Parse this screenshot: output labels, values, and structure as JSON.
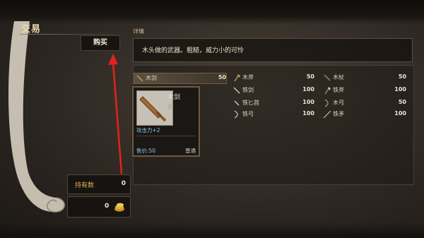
{
  "screen": {
    "title": "交易",
    "buy_label": "购买",
    "detail_label": "详情"
  },
  "description": "木头做的武器。粗糙，威力小的可怜",
  "items": [
    {
      "name": "木剑",
      "price": "50",
      "icon": "sword-icon"
    },
    {
      "name": "木斧",
      "price": "50",
      "icon": "axe-icon"
    },
    {
      "name": "木杖",
      "price": "50",
      "icon": "staff-icon"
    },
    {
      "name": "铁剑",
      "price": "100",
      "icon": "sword-icon"
    },
    {
      "name": "铁斧",
      "price": "100",
      "icon": "axe-icon"
    },
    {
      "name": "铁匕首",
      "price": "100",
      "icon": "dagger-icon"
    },
    {
      "name": "木弓",
      "price": "50",
      "icon": "bow-icon"
    },
    {
      "name": "铁弓",
      "price": "100",
      "icon": "bow-icon"
    },
    {
      "name": "铁矛",
      "price": "100",
      "icon": "spear-icon"
    }
  ],
  "selected_card": {
    "name": "木剑",
    "type": "剑",
    "attack": "攻击力+2",
    "price": "售价:50",
    "grade": "普通"
  },
  "holdings": {
    "label": "持有数",
    "value": "0"
  },
  "gold": {
    "value": "0"
  },
  "colors": {
    "accent_arrow": "#e2231a",
    "text_gold": "#e0b050",
    "text_blue": "#88c8e8"
  }
}
